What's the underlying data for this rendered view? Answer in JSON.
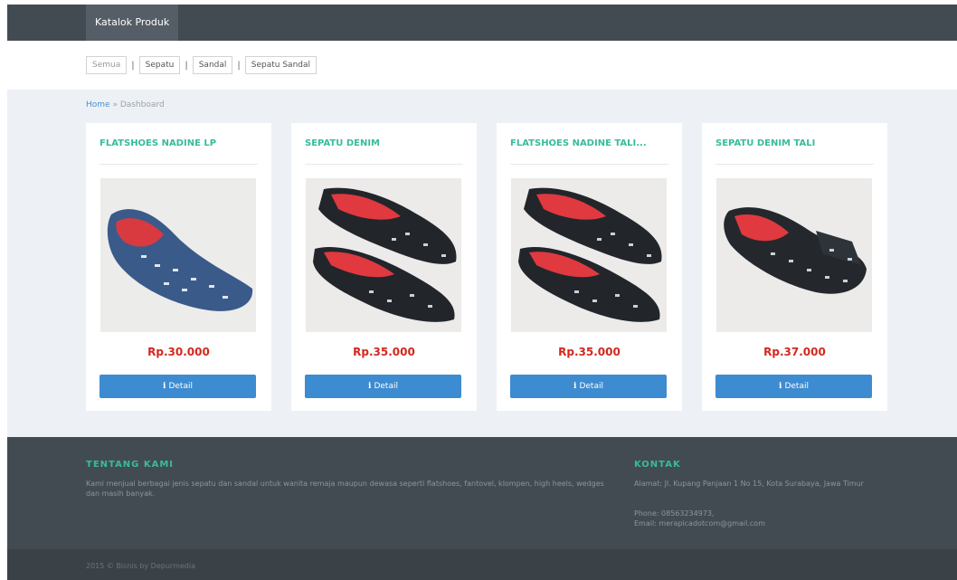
{
  "navbar": {
    "brand": "Katalok Produk"
  },
  "filters": [
    {
      "label": "Semua"
    },
    {
      "label": "Sepatu"
    },
    {
      "label": "Sandal"
    },
    {
      "label": "Sepatu Sandal"
    }
  ],
  "filter_separator": "|",
  "breadcrumb": {
    "home": "Home",
    "sep": "»",
    "current": "Dashboard"
  },
  "products": [
    {
      "title": "FLATSHOES NADINE LP",
      "price": "Rp.30.000",
      "button": "Detail",
      "image": "blue-denim-flat-shoe"
    },
    {
      "title": "SEPATU DENIM",
      "price": "Rp.35.000",
      "button": "Detail",
      "image": "black-denim-flat-shoes-pair"
    },
    {
      "title": "FLATSHOES NADINE TALI...",
      "price": "Rp.35.000",
      "button": "Detail",
      "image": "black-denim-flat-shoes-pair"
    },
    {
      "title": "SEPATU DENIM TALI",
      "price": "Rp.37.000",
      "button": "Detail",
      "image": "black-denim-flat-shoe"
    }
  ],
  "detail_icon": "info-icon",
  "detail_icon_glyph": "i",
  "footer": {
    "about_title": "TENTANG KAMI",
    "about_text": "Kami menjual berbagai jenis sepatu dan sandal untuk wanita remaja maupun dewasa seperti flatshoes, fantovel, klompen, high heels, wedges dan masih banyak.",
    "contact_title": "KONTAK",
    "address": "Alamat: Jl. Kupang Panjaan 1 No 15, Kota Surabaya, Jawa Timur",
    "phone": "Phone: 08563234973,",
    "email": "Email: merapicadotcom@gmail.com",
    "copyright": "2015 © Bisnis by Depurmedia"
  },
  "colors": {
    "navbar": "#434b52",
    "accent_teal": "#37bc9b",
    "price_red": "#d3281e",
    "button_blue": "#3d8bd0",
    "page_bg": "#edf1f5"
  }
}
